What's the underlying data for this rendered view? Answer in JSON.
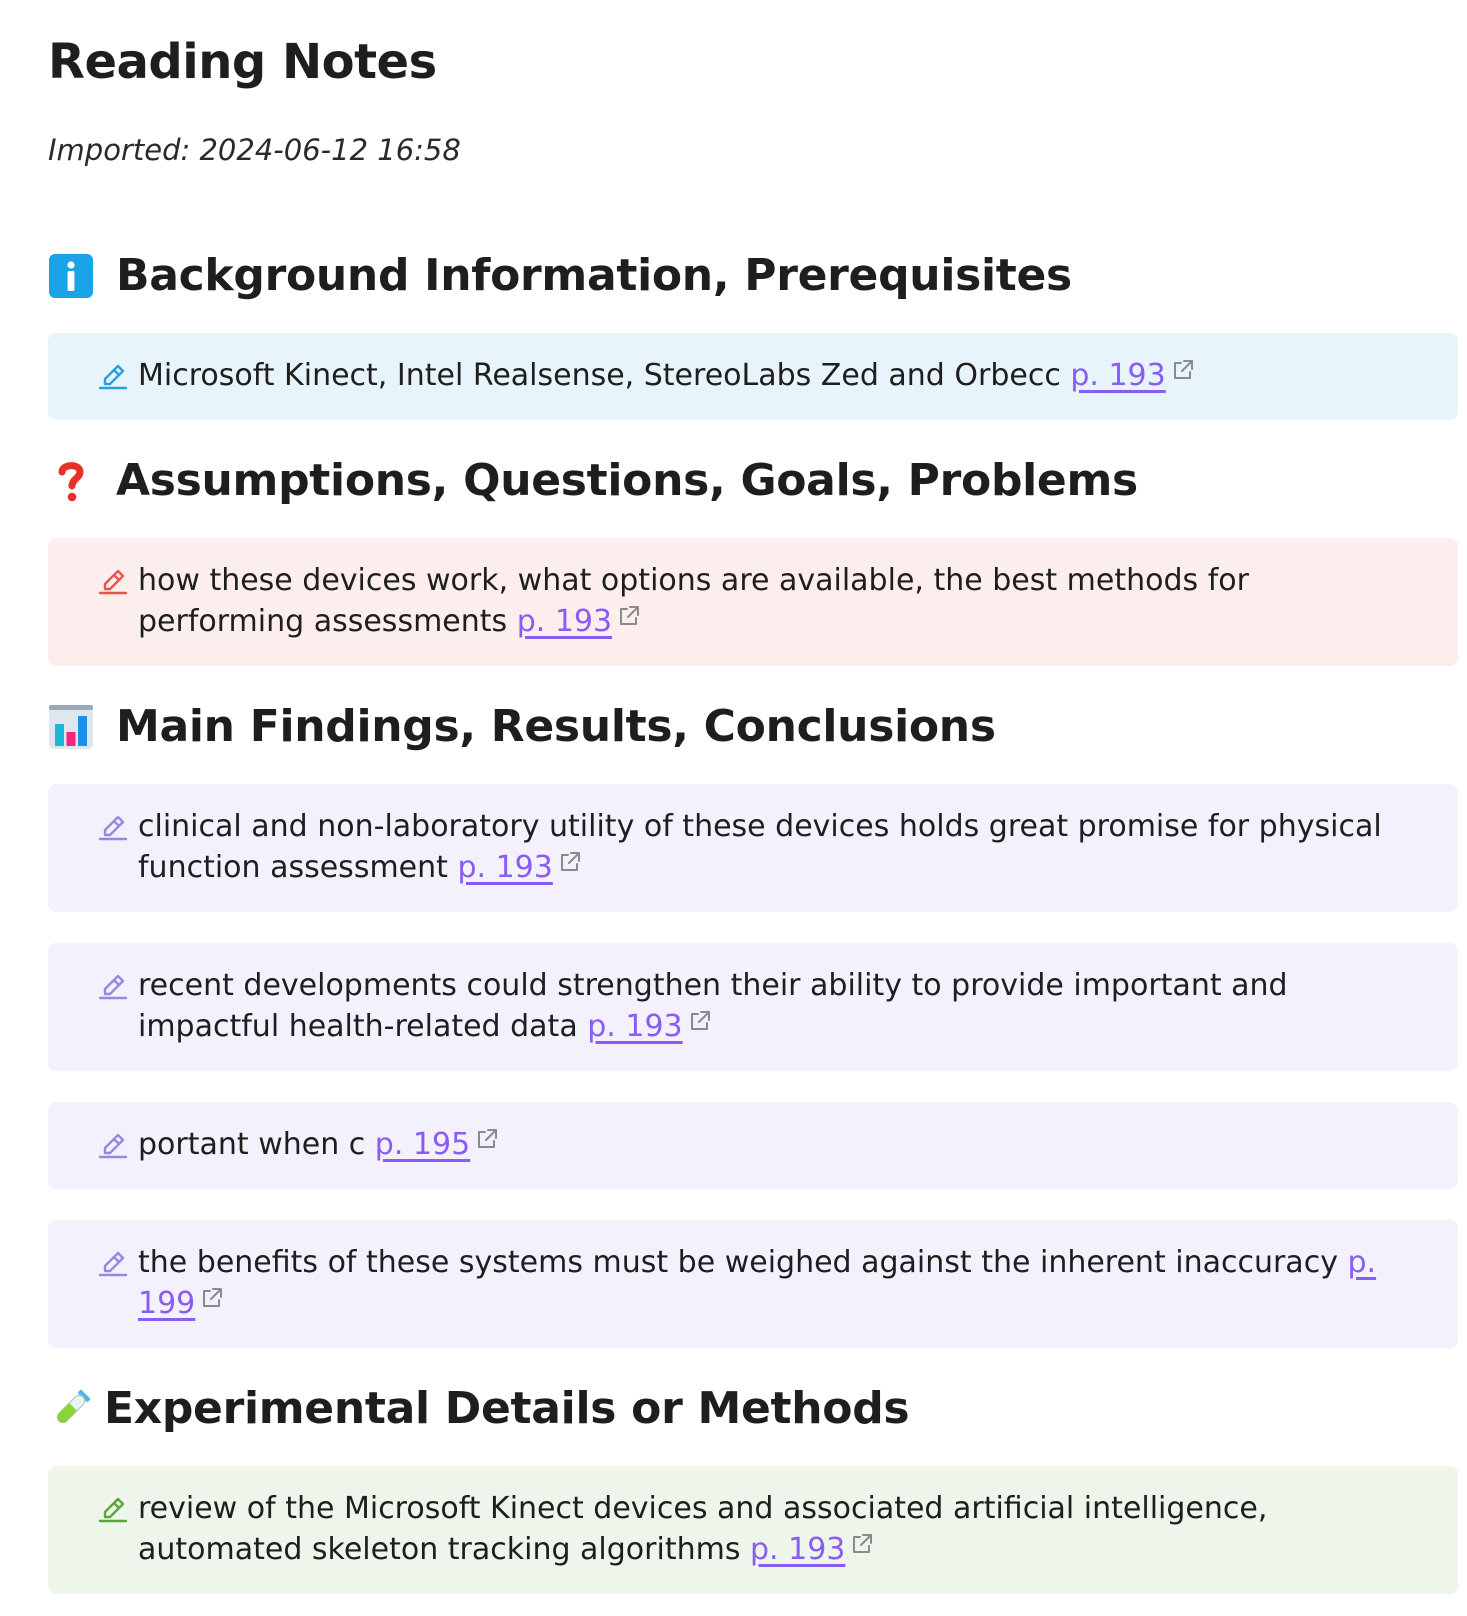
{
  "title": "Reading Notes",
  "imported": "Imported: 2024-06-12 16:58",
  "colors": {
    "blue_bg": "#e8f4fb",
    "red_bg": "#fdeeee",
    "purple_bg": "#f3f1fc",
    "green_bg": "#eef5ea",
    "link": "#8a5cf5",
    "info_icon": "#1aa3e8"
  },
  "sections": [
    {
      "icon": "info-icon",
      "heading": "Background Information, Prerequisites",
      "notes": [
        {
          "text": "Microsoft Kinect, Intel Realsense, StereoLabs Zed and Orbecc",
          "page": "p. 193"
        }
      ]
    },
    {
      "icon": "question-mark-icon",
      "heading": "Assumptions, Questions, Goals, Problems",
      "notes": [
        {
          "text": "how these devices work, what options are available, the best methods for performing assessments",
          "page": "p. 193"
        }
      ]
    },
    {
      "icon": "bar-chart-icon",
      "heading": "Main Findings, Results, Conclusions",
      "notes": [
        {
          "text": "clinical and non-laboratory utility of these devices holds great promise for physical function assessment",
          "page": "p. 193"
        },
        {
          "text": "recent developments could strengthen their ability to provide important and impactful health-related data",
          "page": "p. 193"
        },
        {
          "text": "portant when c",
          "page": "p. 195"
        },
        {
          "text": "the benefits of these systems must be weighed against the inherent inaccuracy",
          "page": "p. 199"
        }
      ]
    },
    {
      "icon": "test-tube-icon",
      "heading": "Experimental Details or Methods",
      "notes": [
        {
          "text": "review of the Microsoft Kinect devices and associated artificial intelligence, automated skeleton tracking algorithms",
          "page": "p. 193"
        }
      ]
    }
  ]
}
